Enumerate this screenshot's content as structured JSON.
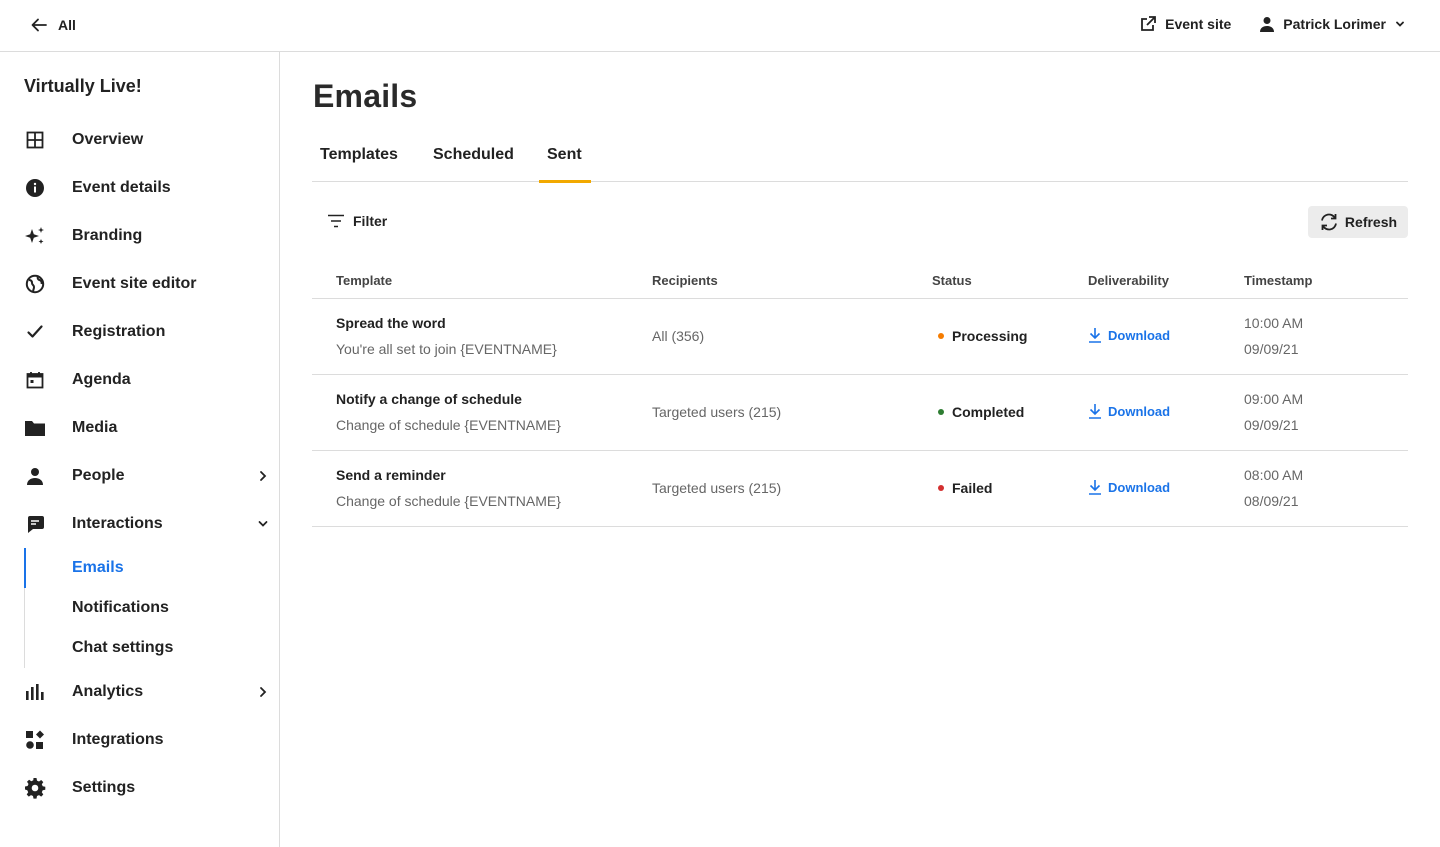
{
  "topbar": {
    "back_label": "All",
    "event_site_label": "Event site",
    "user_name": "Patrick Lorimer"
  },
  "sidebar": {
    "brand": "Virtually Live!",
    "items": [
      {
        "label": "Overview",
        "icon": "grid-icon"
      },
      {
        "label": "Event details",
        "icon": "info-icon"
      },
      {
        "label": "Branding",
        "icon": "sparkle-icon"
      },
      {
        "label": "Event site editor",
        "icon": "globe-icon"
      },
      {
        "label": "Registration",
        "icon": "check-icon"
      },
      {
        "label": "Agenda",
        "icon": "calendar-icon"
      },
      {
        "label": "Media",
        "icon": "folder-icon"
      },
      {
        "label": "People",
        "icon": "person-icon"
      },
      {
        "label": "Interactions",
        "icon": "chat-icon"
      }
    ],
    "sub_items": [
      {
        "label": "Emails",
        "active": true
      },
      {
        "label": "Notifications",
        "active": false
      },
      {
        "label": "Chat settings",
        "active": false
      }
    ],
    "bottom_items": [
      {
        "label": "Analytics",
        "icon": "bar-chart-icon"
      },
      {
        "label": "Integrations",
        "icon": "shapes-icon"
      },
      {
        "label": "Settings",
        "icon": "gear-icon"
      }
    ]
  },
  "main": {
    "title": "Emails",
    "tabs": [
      {
        "label": "Templates"
      },
      {
        "label": "Scheduled"
      },
      {
        "label": "Sent",
        "active": true
      }
    ],
    "filter_label": "Filter",
    "refresh_label": "Refresh",
    "columns": [
      "Template",
      "Recipients",
      "Status",
      "Deliverability",
      "Timestamp"
    ],
    "rows": [
      {
        "title": "Spread the word",
        "subject": "You're all set to join {EVENTNAME}",
        "recipients": "All (356)",
        "status": "Processing",
        "status_color": "#f57c00",
        "deliverability": "Download",
        "time": "10:00 AM",
        "date": "09/09/21"
      },
      {
        "title": "Notify a change of schedule",
        "subject": "Change of schedule {EVENTNAME}",
        "recipients": "Targeted users (215)",
        "status": "Completed",
        "status_color": "#2e7d32",
        "deliverability": "Download",
        "time": "09:00 AM",
        "date": "09/09/21"
      },
      {
        "title": "Send a reminder",
        "subject": "Change of schedule {EVENTNAME}",
        "recipients": "Targeted users (215)",
        "status": "Failed",
        "status_color": "#d32f2f",
        "deliverability": "Download",
        "time": "08:00 AM",
        "date": "08/09/21"
      }
    ]
  },
  "colors": {
    "accent_blue": "#1a73e8",
    "tab_underline": "#f2a900"
  }
}
